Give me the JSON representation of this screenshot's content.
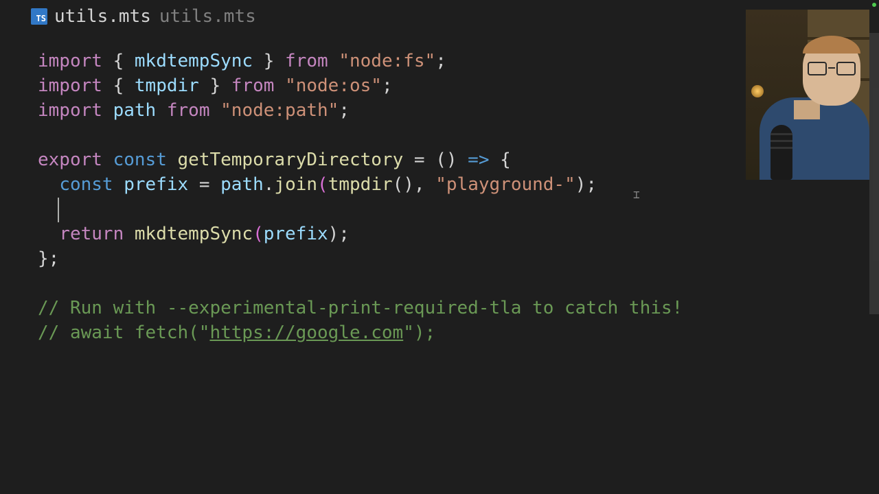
{
  "tab": {
    "icon": "TS",
    "name": "utils.mts",
    "path": "utils.mts"
  },
  "code": {
    "l1": {
      "t1": "import",
      "t2": " { ",
      "t3": "mkdtempSync",
      "t4": " } ",
      "t5": "from",
      "t6": " ",
      "t7": "\"node:fs\"",
      "t8": ";"
    },
    "l2": {
      "t1": "import",
      "t2": " { ",
      "t3": "tmpdir",
      "t4": " } ",
      "t5": "from",
      "t6": " ",
      "t7": "\"node:os\"",
      "t8": ";"
    },
    "l3": {
      "t1": "import",
      "t2": " ",
      "t3": "path",
      "t4": " ",
      "t5": "from",
      "t6": " ",
      "t7": "\"node:path\"",
      "t8": ";"
    },
    "l5": {
      "t1": "export",
      "t2": " ",
      "t3": "const",
      "t4": " ",
      "t5": "getTemporaryDirectory",
      "t6": " = () ",
      "t7": "=>",
      "t8": " {"
    },
    "l6": {
      "t1": "  ",
      "t2": "const",
      "t3": " ",
      "t4": "prefix",
      "t5": " = ",
      "t6": "path",
      "t7": ".",
      "t8": "join",
      "t9": "(",
      "t10": "tmpdir",
      "t11": "(), ",
      "t12": "\"playground-\"",
      "t13": ");"
    },
    "l8": {
      "t1": "  ",
      "t2": "return",
      "t3": " ",
      "t4": "mkdtempSync",
      "t5": "(",
      "t6": "prefix",
      "t7": ");"
    },
    "l9": {
      "t1": "};"
    },
    "l11": {
      "t1": "// Run with --experimental-print-required-tla to catch this!"
    },
    "l12": {
      "t1": "// await fetch(\"",
      "t2": "https://google.com",
      "t3": "\");"
    }
  }
}
